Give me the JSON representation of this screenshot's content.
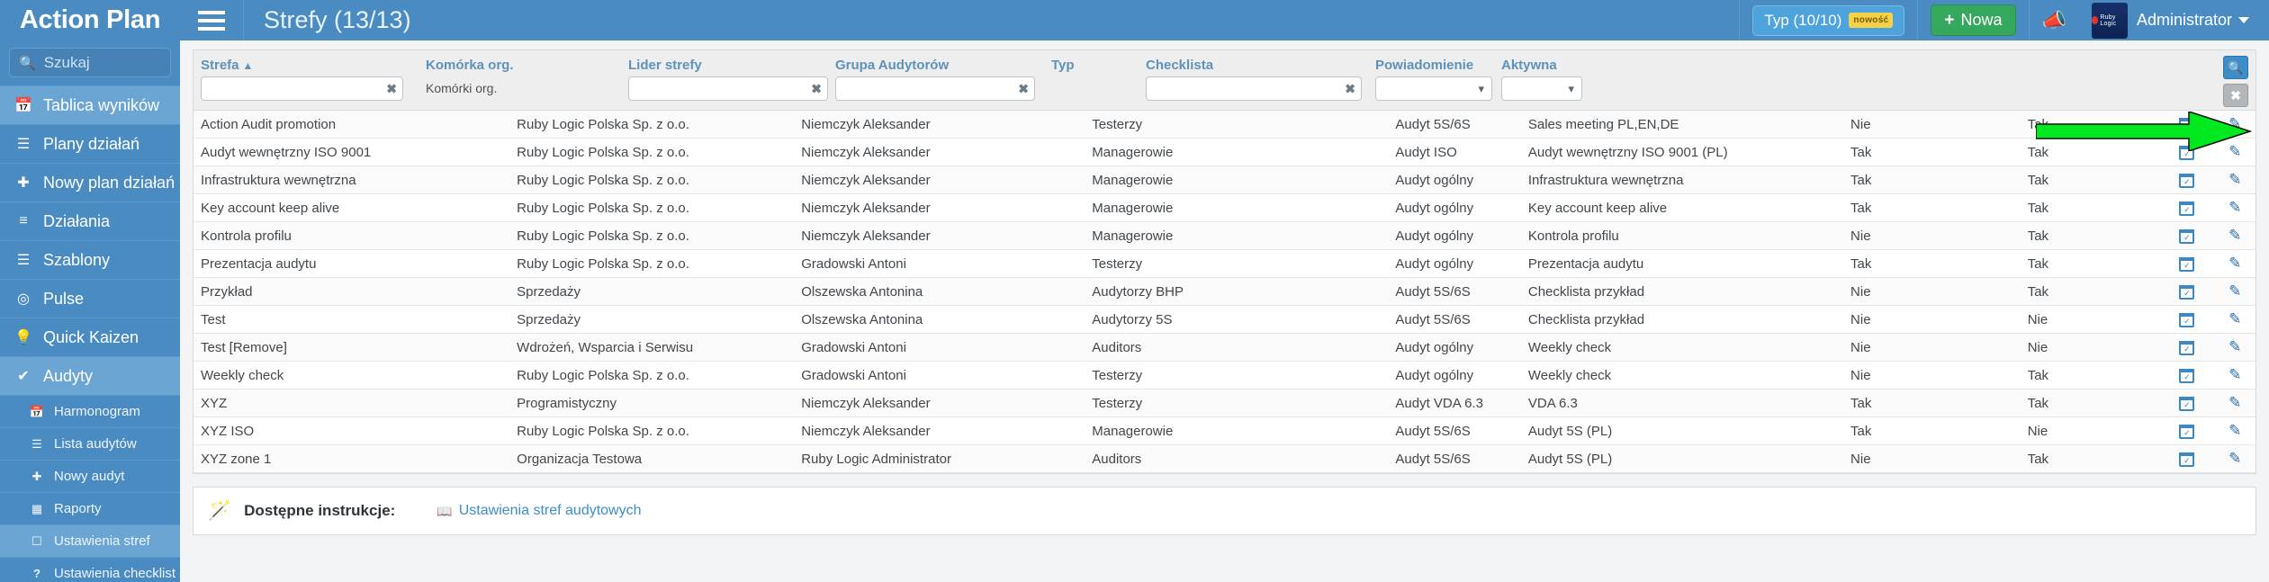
{
  "topbar": {
    "brand": "Action Plan",
    "menu_icon": "hamburger-icon",
    "page_title": "Strefy (13/13)",
    "typ_button": "Typ (10/10)",
    "typ_badge": "nowość",
    "new_button": "Nowa",
    "new_plus": "+",
    "announce_icon": "megaphone-icon",
    "logo_text": "Ruby Logic",
    "user": "Administrator"
  },
  "sidebar": {
    "search_placeholder": "Szukaj",
    "search_value": "",
    "items": [
      {
        "label": "Tablica wyników",
        "icon": "calendar-icon",
        "active": true
      },
      {
        "label": "Plany działań",
        "icon": "list-icon",
        "active": false
      },
      {
        "label": "Nowy plan działań",
        "icon": "plus-icon",
        "active": false
      },
      {
        "label": "Działania",
        "icon": "sliders-icon",
        "active": false
      },
      {
        "label": "Szablony",
        "icon": "bars-icon",
        "active": false
      },
      {
        "label": "Pulse",
        "icon": "target-icon",
        "active": false
      },
      {
        "label": "Quick Kaizen",
        "icon": "lightbulb-icon",
        "active": false
      },
      {
        "label": "Audyty",
        "icon": "check-icon",
        "active": true
      }
    ],
    "subitems": [
      {
        "label": "Harmonogram",
        "icon": "calendar-icon",
        "active": false
      },
      {
        "label": "Lista audytów",
        "icon": "list-icon",
        "active": false
      },
      {
        "label": "Nowy audyt",
        "icon": "plus-icon",
        "active": false
      },
      {
        "label": "Raporty",
        "icon": "table-icon",
        "active": false
      },
      {
        "label": "Ustawienia stref",
        "icon": "square-icon",
        "active": true
      },
      {
        "label": "Ustawienia checklist",
        "icon": "question-icon",
        "active": false
      }
    ]
  },
  "filters": {
    "strefa": {
      "header": "Strefa",
      "sort": "▲",
      "value": "",
      "clear": "✖"
    },
    "komorka": {
      "header": "Komórka org.",
      "static": "Komórki org."
    },
    "lider": {
      "header": "Lider strefy",
      "value": "",
      "clear": "✖"
    },
    "grupa": {
      "header": "Grupa Audytorów",
      "value": "",
      "clear": "✖"
    },
    "typ": {
      "header": "Typ"
    },
    "checklista": {
      "header": "Checklista",
      "value": "",
      "clear": "✖"
    },
    "powiadomienie": {
      "header": "Powiadomienie",
      "value": ""
    },
    "aktywna": {
      "header": "Aktywna",
      "value": ""
    },
    "search_button": "search-icon",
    "clear_button": "✖"
  },
  "table": {
    "columns": [
      "Strefa",
      "Komórka org.",
      "Lider strefy",
      "Grupa Audytorów",
      "Typ",
      "Checklista",
      "Powiadomienie",
      "Aktywna",
      "",
      ""
    ],
    "rows": [
      {
        "strefa": "Action Audit promotion",
        "komorka": "Ruby Logic Polska Sp. z o.o.",
        "lider": "Niemczyk Aleksander",
        "grupa": "Testerzy",
        "typ": "Audyt 5S/6S",
        "checklista": "Sales meeting PL,EN,DE",
        "powiadomienie": "Nie",
        "aktywna": "Tak"
      },
      {
        "strefa": "Audyt wewnętrzny ISO 9001",
        "komorka": "Ruby Logic Polska Sp. z o.o.",
        "lider": "Niemczyk Aleksander",
        "grupa": "Managerowie",
        "typ": "Audyt ISO",
        "checklista": "Audyt wewnętrzny ISO 9001 (PL)",
        "powiadomienie": "Tak",
        "aktywna": "Tak"
      },
      {
        "strefa": "Infrastruktura wewnętrzna",
        "komorka": "Ruby Logic Polska Sp. z o.o.",
        "lider": "Niemczyk Aleksander",
        "grupa": "Managerowie",
        "typ": "Audyt ogólny",
        "checklista": "Infrastruktura wewnętrzna",
        "powiadomienie": "Tak",
        "aktywna": "Tak"
      },
      {
        "strefa": "Key account keep alive",
        "komorka": "Ruby Logic Polska Sp. z o.o.",
        "lider": "Niemczyk Aleksander",
        "grupa": "Managerowie",
        "typ": "Audyt ogólny",
        "checklista": "Key account keep alive",
        "powiadomienie": "Tak",
        "aktywna": "Tak"
      },
      {
        "strefa": "Kontrola profilu",
        "komorka": "Ruby Logic Polska Sp. z o.o.",
        "lider": "Niemczyk Aleksander",
        "grupa": "Managerowie",
        "typ": "Audyt ogólny",
        "checklista": "Kontrola profilu",
        "powiadomienie": "Nie",
        "aktywna": "Tak"
      },
      {
        "strefa": "Prezentacja audytu",
        "komorka": "Ruby Logic Polska Sp. z o.o.",
        "lider": "Gradowski Antoni",
        "grupa": "Testerzy",
        "typ": "Audyt ogólny",
        "checklista": "Prezentacja audytu",
        "powiadomienie": "Tak",
        "aktywna": "Tak"
      },
      {
        "strefa": "Przykład",
        "komorka": "Sprzedaży",
        "lider": "Olszewska Antonina",
        "grupa": "Audytorzy BHP",
        "typ": "Audyt 5S/6S",
        "checklista": "Checklista przykład",
        "powiadomienie": "Nie",
        "aktywna": "Tak"
      },
      {
        "strefa": "Test",
        "komorka": "Sprzedaży",
        "lider": "Olszewska Antonina",
        "grupa": "Audytorzy 5S",
        "typ": "Audyt 5S/6S",
        "checklista": "Checklista przykład",
        "powiadomienie": "Nie",
        "aktywna": "Nie"
      },
      {
        "strefa": "Test [Remove]",
        "komorka": "Wdrożeń, Wsparcia i Serwisu",
        "lider": "Gradowski Antoni",
        "grupa": "Auditors",
        "typ": "Audyt ogólny",
        "checklista": "Weekly check",
        "powiadomienie": "Nie",
        "aktywna": "Nie"
      },
      {
        "strefa": "Weekly check",
        "komorka": "Ruby Logic Polska Sp. z o.o.",
        "lider": "Gradowski Antoni",
        "grupa": "Testerzy",
        "typ": "Audyt ogólny",
        "checklista": "Weekly check",
        "powiadomienie": "Nie",
        "aktywna": "Tak"
      },
      {
        "strefa": "XYZ",
        "komorka": "Programistyczny",
        "lider": "Niemczyk Aleksander",
        "grupa": "Testerzy",
        "typ": "Audyt VDA 6.3",
        "checklista": "VDA 6.3",
        "powiadomienie": "Tak",
        "aktywna": "Tak"
      },
      {
        "strefa": "XYZ ISO",
        "komorka": "Ruby Logic Polska Sp. z o.o.",
        "lider": "Niemczyk Aleksander",
        "grupa": "Managerowie",
        "typ": "Audyt 5S/6S",
        "checklista": "Audyt 5S (PL)",
        "powiadomienie": "Tak",
        "aktywna": "Nie"
      },
      {
        "strefa": "XYZ zone 1",
        "komorka": "Organizacja Testowa",
        "lider": "Ruby Logic Administrator",
        "grupa": "Auditors",
        "typ": "Audyt 5S/6S",
        "checklista": "Audyt 5S (PL)",
        "powiadomienie": "Nie",
        "aktywna": "Tak"
      }
    ],
    "row_actions": {
      "schedule_icon": "calendar-check-icon",
      "edit_icon": "pencil-icon"
    }
  },
  "instructions": {
    "wand_icon": "magic-wand-icon",
    "label": "Dostępne instrukcje:",
    "link_icon": "book-icon",
    "link": "Ustawienia stref audytowych"
  },
  "colors": {
    "brand_blue": "#4a8bc2",
    "accent_green": "#36a85d",
    "badge_yellow": "#f5d147",
    "header_text_blue": "#5d92ba",
    "arrow_green": "#00e81e"
  }
}
